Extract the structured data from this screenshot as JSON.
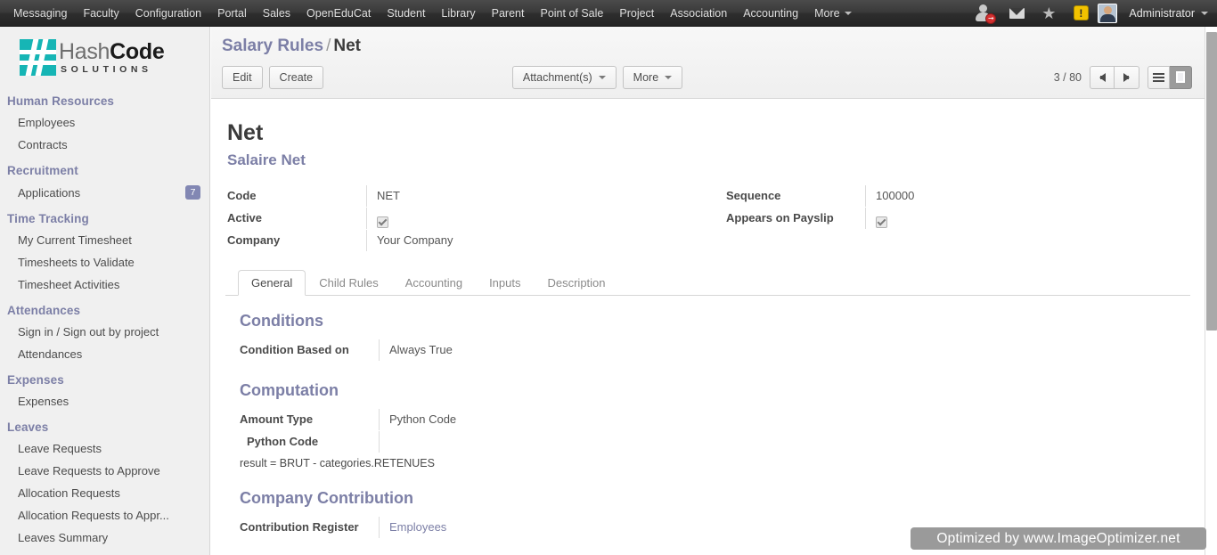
{
  "topnav": {
    "items": [
      {
        "label": "Messaging"
      },
      {
        "label": "Faculty"
      },
      {
        "label": "Configuration"
      },
      {
        "label": "Portal"
      },
      {
        "label": "Sales"
      },
      {
        "label": "OpenEduCat"
      },
      {
        "label": "Student"
      },
      {
        "label": "Library"
      },
      {
        "label": "Parent"
      },
      {
        "label": "Point of Sale"
      },
      {
        "label": "Project"
      },
      {
        "label": "Association"
      },
      {
        "label": "Accounting"
      }
    ],
    "more_label": "More",
    "icons": {
      "userplus": "user-plus-icon",
      "mail": "mail-icon",
      "star": "star-icon",
      "warning": "warning-icon"
    },
    "warning_glyph": "!",
    "star_glyph": "★",
    "user_label": "Administrator"
  },
  "sidebar": {
    "logo": {
      "hash": "Hash",
      "code": "Code",
      "sub": "SOLUTIONS",
      "mark_color": "#16b5b5"
    },
    "groups": [
      {
        "title": "Human Resources",
        "items": [
          {
            "label": "Employees",
            "badge": ""
          },
          {
            "label": "Contracts",
            "badge": ""
          }
        ]
      },
      {
        "title": "Recruitment",
        "items": [
          {
            "label": "Applications",
            "badge": "7"
          }
        ]
      },
      {
        "title": "Time Tracking",
        "items": [
          {
            "label": "My Current Timesheet",
            "badge": ""
          },
          {
            "label": "Timesheets to Validate",
            "badge": ""
          },
          {
            "label": "Timesheet Activities",
            "badge": ""
          }
        ]
      },
      {
        "title": "Attendances",
        "items": [
          {
            "label": "Sign in / Sign out by project",
            "badge": ""
          },
          {
            "label": "Attendances",
            "badge": ""
          }
        ]
      },
      {
        "title": "Expenses",
        "items": [
          {
            "label": "Expenses",
            "badge": ""
          }
        ]
      },
      {
        "title": "Leaves",
        "items": [
          {
            "label": "Leave Requests",
            "badge": ""
          },
          {
            "label": "Leave Requests to Approve",
            "badge": ""
          },
          {
            "label": "Allocation Requests",
            "badge": ""
          },
          {
            "label": "Allocation Requests to Appr...",
            "badge": ""
          },
          {
            "label": "Leaves Summary",
            "badge": ""
          }
        ]
      }
    ]
  },
  "control_panel": {
    "breadcrumb_parent": "Salary Rules",
    "breadcrumb_sep": "/",
    "breadcrumb_current": "Net",
    "edit_label": "Edit",
    "create_label": "Create",
    "attachments_label": "Attachment(s)",
    "more_label": "More",
    "pager_text": "3 / 80"
  },
  "record": {
    "title": "Net",
    "subtitle": "Salaire Net",
    "left_fields": [
      {
        "label": "Code",
        "value": "NET",
        "type": "text"
      },
      {
        "label": "Active",
        "value": "",
        "type": "checkbox"
      },
      {
        "label": "Company",
        "value": "Your Company",
        "type": "text"
      }
    ],
    "right_fields": [
      {
        "label": "Sequence",
        "value": "100000",
        "type": "text"
      },
      {
        "label": "Appears on Payslip",
        "value": "",
        "type": "checkbox"
      }
    ]
  },
  "tabs": [
    {
      "label": "General",
      "active": true
    },
    {
      "label": "Child Rules",
      "active": false
    },
    {
      "label": "Accounting",
      "active": false
    },
    {
      "label": "Inputs",
      "active": false
    },
    {
      "label": "Description",
      "active": false
    }
  ],
  "general_tab": {
    "conditions": {
      "title": "Conditions",
      "field_label": "Condition Based on",
      "field_value": "Always True"
    },
    "computation": {
      "title": "Computation",
      "amount_type_label": "Amount Type",
      "amount_type_value": "Python Code",
      "python_code_label": "Python Code",
      "python_code_value": "result = BRUT - categories.RETENUES"
    },
    "company_contribution": {
      "title": "Company Contribution",
      "register_label": "Contribution Register",
      "register_value": "Employees"
    }
  },
  "watermark": {
    "text": "Optimized by www.ImageOptimizer.net"
  }
}
